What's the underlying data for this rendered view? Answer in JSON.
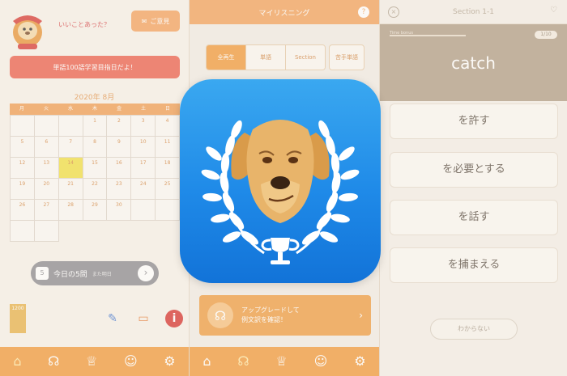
{
  "home": {
    "bubble": "いいことあった？",
    "mail_label": "ご意見",
    "goal_banner": "単語100語学習目指日だよ！",
    "calendar_title": "2020年 8月",
    "weekdays": [
      "月",
      "火",
      "水",
      "木",
      "金",
      "土",
      "日"
    ],
    "days": [
      "",
      "",
      "",
      "1",
      "2",
      "3",
      "4",
      "5",
      "6",
      "7",
      "8",
      "9",
      "10",
      "11",
      "12",
      "13",
      "14",
      "15",
      "16",
      "17",
      "18",
      "19",
      "20",
      "21",
      "22",
      "23",
      "24",
      "25",
      "26",
      "27",
      "28",
      "29",
      "30",
      "",
      "",
      "",
      ""
    ],
    "today": "14",
    "today_count": "5",
    "today_label": "今日の5問",
    "today_sub": "また明日",
    "level_badge": "1200"
  },
  "listening": {
    "title": "マイリスニング",
    "segments": [
      "全再生",
      "単語",
      "Section"
    ],
    "weak_label": "苦手単語",
    "upgrade_line1": "アップグレードして",
    "upgrade_line2": "例文訳を確認！"
  },
  "quiz": {
    "title": "Section 1-1",
    "time_label": "Time bonus",
    "counter": "1/10",
    "word": "catch",
    "choices": [
      "を許す",
      "を必要とする",
      "を話す",
      "を捕まえる"
    ],
    "unknown_label": "わからない"
  },
  "tabs": [
    "home-icon",
    "headphones-icon",
    "trophy-icon",
    "profile-icon",
    "settings-icon"
  ],
  "colors": {
    "orange": "#f29c40",
    "red": "#ec6452",
    "icon_blue": "#1f8ae8",
    "card_brown": "#b3a08a"
  }
}
